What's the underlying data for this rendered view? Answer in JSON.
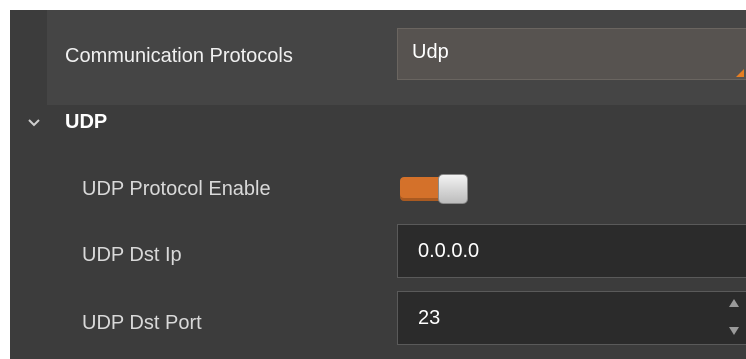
{
  "comm": {
    "label": "Communication Protocols",
    "value": "Udp"
  },
  "udp_section": {
    "title": "UDP",
    "expanded": true
  },
  "udp_enable": {
    "label": "UDP Protocol Enable",
    "on": true
  },
  "udp_dst_ip": {
    "label": "UDP Dst Ip",
    "value": "0.0.0.0"
  },
  "udp_dst_port": {
    "label": "UDP Dst Port",
    "value": "23"
  },
  "colors": {
    "panel_bg": "#3c3c3c",
    "accent": "#d4712a",
    "input_bg": "#2b2b2b"
  }
}
